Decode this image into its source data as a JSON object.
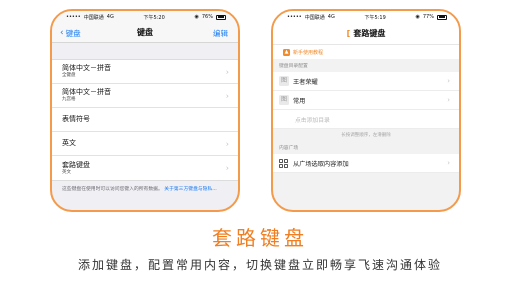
{
  "left_phone": {
    "status": {
      "signal": "•••••",
      "carrier": "中国联通",
      "network": "4G",
      "time": "下午5:20",
      "battery": "76%"
    },
    "nav": {
      "back_label": "键盘",
      "title": "键盘",
      "edit_label": "编辑"
    },
    "keyboards": [
      {
        "title": "简体中文－拼音",
        "subtitle": "全键盘"
      },
      {
        "title": "简体中文－拼音",
        "subtitle": "九宫格"
      },
      {
        "title": "表情符号",
        "subtitle": ""
      },
      {
        "title": "英文",
        "subtitle": ""
      },
      {
        "title": "套路键盘",
        "subtitle": "英文"
      }
    ],
    "footnote": {
      "text": "这些键盘在使用时可以访问您键入的所有数据。",
      "link": "关于第三方键盘与隐私..."
    }
  },
  "right_phone": {
    "status": {
      "signal": "•••••",
      "carrier": "中国联通",
      "network": "4G",
      "time": "下午5:19",
      "battery": "77%"
    },
    "nav": {
      "logo_icon": "[",
      "title": "套路键盘"
    },
    "tutorial_label": "新手使用教程",
    "directory_section": "键盘目录配置",
    "directories": [
      {
        "label": "王者荣耀",
        "icon": "图"
      },
      {
        "label": "常用",
        "icon": "图"
      }
    ],
    "add_placeholder": "点击添加目录",
    "hint": "长按调整顺序，左滑删除",
    "plaza_section": "内容广场",
    "plaza_item": "从广场选取内容添加"
  },
  "headline": "套路键盘",
  "subline": "添加键盘，配置常用内容，切换键盘立即畅享飞速沟通体验",
  "colors": {
    "accent": "#f39a4b",
    "ios_blue": "#1a7cf2",
    "headline": "#ef7f22"
  }
}
